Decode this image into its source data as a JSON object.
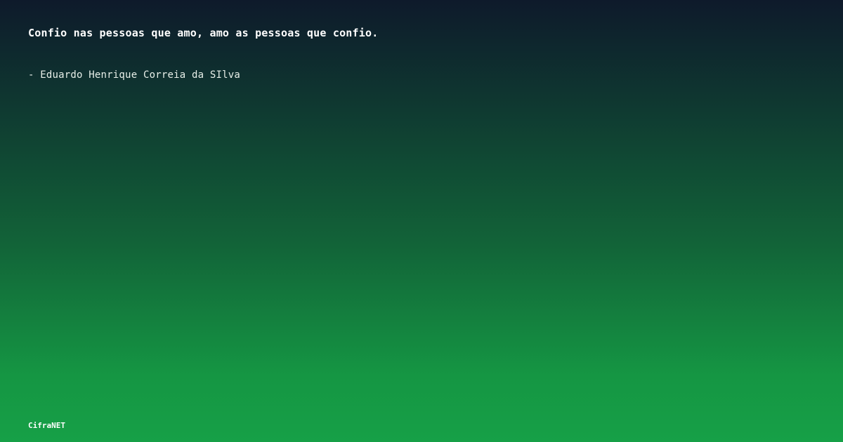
{
  "quote": {
    "text": "Confio nas pessoas que amo, amo as pessoas que confio.",
    "author": "- Eduardo Henrique Correia da SIlva"
  },
  "brand": {
    "name": "CifraNET"
  },
  "colors": {
    "gradient_top": "#0e1a2b",
    "gradient_bottom": "#16a047",
    "text": "#ffffff"
  }
}
